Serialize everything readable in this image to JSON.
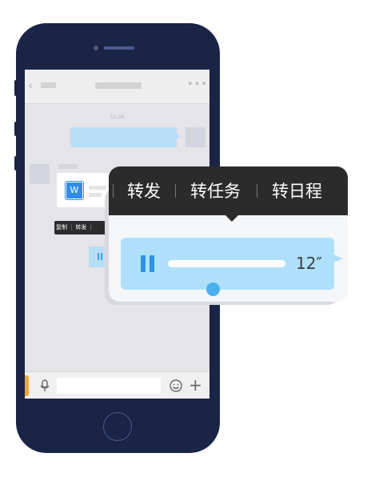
{
  "colors": {
    "phone_body": "#1a2446",
    "screen_bg": "#e4e4e9",
    "outgoing_bubble": "#b8ddf7",
    "voice_bubble": "#aee0fb",
    "accent_blue": "#2f93e0",
    "menu_bg": "#2b2b2b",
    "keyboard_tab": "#f2a43a"
  },
  "chat": {
    "timestamp": "11:26",
    "file_icon_letter": "W",
    "icons": {
      "back": "chevron-left-icon",
      "more": "more-dots-icon",
      "file": "word-file-icon",
      "pause": "pause-icon",
      "mic": "microphone-icon",
      "emoji": "emoji-icon",
      "plus": "plus-icon"
    },
    "small_menu": {
      "items": [
        "复制",
        "转发"
      ]
    }
  },
  "context_menu": {
    "items": [
      {
        "label": "转发"
      },
      {
        "label": "转任务"
      },
      {
        "label": "转日程"
      }
    ]
  },
  "voice_message": {
    "duration": "12″",
    "progress": 0
  }
}
